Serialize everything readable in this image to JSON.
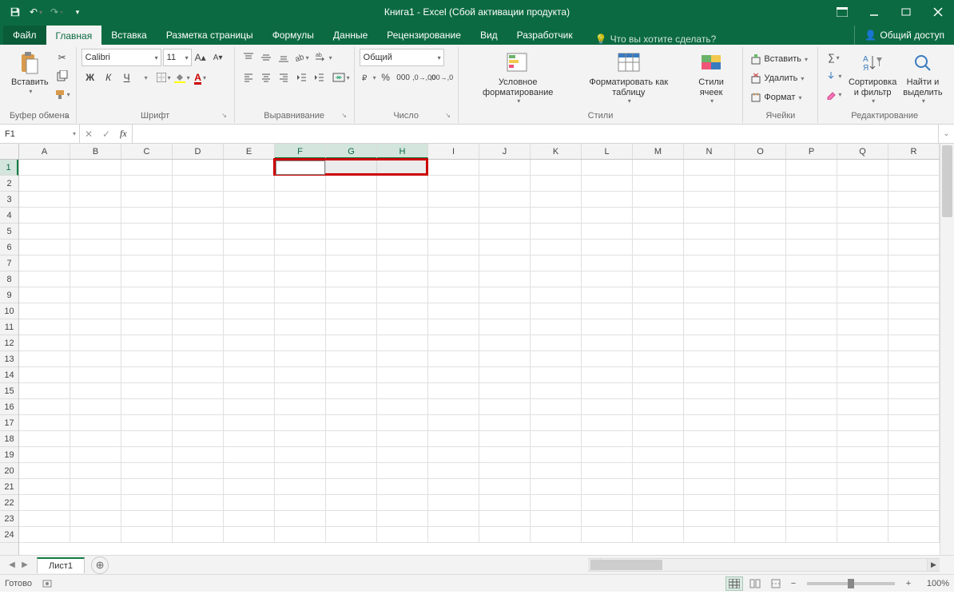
{
  "title": "Книга1 - Excel (Сбой активации продукта)",
  "qat": {
    "save": "save",
    "undo": "undo",
    "redo": "redo"
  },
  "tabs": {
    "file": "Файл",
    "home": "Главная",
    "insert": "Вставка",
    "pagelayout": "Разметка страницы",
    "formulas": "Формулы",
    "data": "Данные",
    "review": "Рецензирование",
    "view": "Вид",
    "developer": "Разработчик",
    "tellme": "Что вы хотите сделать?",
    "share": "Общий доступ"
  },
  "ribbon": {
    "clipboard": {
      "paste": "Вставить",
      "label": "Буфер обмена"
    },
    "font": {
      "name": "Calibri",
      "size": "11",
      "label": "Шрифт"
    },
    "alignment": {
      "label": "Выравнивание"
    },
    "number": {
      "format": "Общий",
      "label": "Число"
    },
    "styles": {
      "cond": "Условное форматирование",
      "table": "Форматировать как таблицу",
      "cell": "Стили ячеек",
      "label": "Стили"
    },
    "cells": {
      "insert": "Вставить",
      "delete": "Удалить",
      "format": "Формат",
      "label": "Ячейки"
    },
    "editing": {
      "sort": "Сортировка и фильтр",
      "find": "Найти и выделить",
      "label": "Редактирование"
    }
  },
  "namebox": "F1",
  "formula": "",
  "columns": [
    "A",
    "B",
    "C",
    "D",
    "E",
    "F",
    "G",
    "H",
    "I",
    "J",
    "K",
    "L",
    "M",
    "N",
    "O",
    "P",
    "Q",
    "R"
  ],
  "rows_count": 24,
  "selection": {
    "from_col": 5,
    "to_col": 7,
    "row": 0,
    "active_col": 5
  },
  "sheet": "Лист1",
  "status": "Готово",
  "zoom": "100%"
}
